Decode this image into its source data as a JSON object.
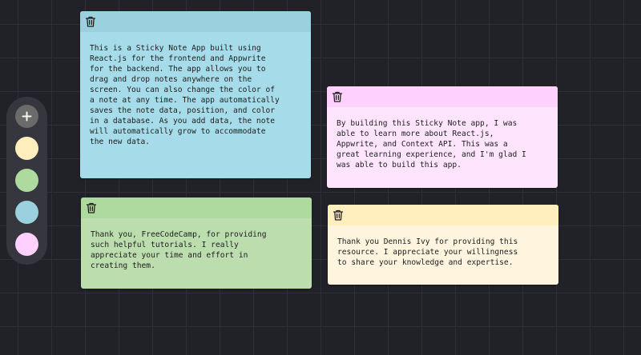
{
  "controls": {
    "add_icon": "plus-icon",
    "colors": [
      {
        "name": "yellow",
        "hex": "#FFEFBE"
      },
      {
        "name": "green",
        "hex": "#AFDA9F"
      },
      {
        "name": "blue",
        "hex": "#9BD1DE"
      },
      {
        "name": "purple",
        "hex": "#FED0FD"
      }
    ]
  },
  "notes": [
    {
      "color": "blue",
      "header_color": "#9BD1DE",
      "body_color": "#A6DCE9",
      "text": "This is a Sticky Note App built using\nReact.js for the frontend and Appwrite\nfor the backend. The app allows you to\ndrag and drop notes anywhere on the\nscreen. You can also change the color of\na note at any time. The app automatically\nsaves the note data, position, and color\nin a database. As you add data, the note\nwill automatically grow to accommodate\nthe new data."
    },
    {
      "color": "purple",
      "header_color": "#FED0FD",
      "body_color": "#FEE5FD",
      "text": "By building this Sticky Note app, I was\nable to learn more about React.js,\nAppwrite, and Context API. This was a\ngreat learning experience, and I'm glad I\nwas able to build this app."
    },
    {
      "color": "green",
      "header_color": "#AFDA9F",
      "body_color": "#BCDEAF",
      "text": "Thank you, FreeCodeCamp, for providing\nsuch helpful tutorials. I really\nappreciate your time and effort in\ncreating them."
    },
    {
      "color": "yellow",
      "header_color": "#FFEFBE",
      "body_color": "#FFF5DF",
      "text": "Thank you Dennis Ivy for providing this\nresource. I appreciate your willingness\nto share your knowledge and expertise."
    }
  ]
}
